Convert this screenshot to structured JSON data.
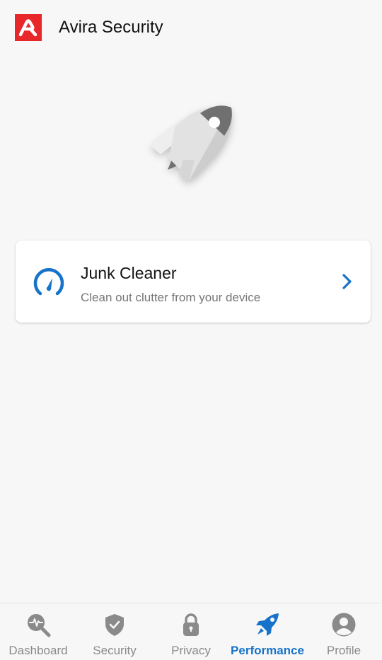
{
  "app": {
    "title": "Avira Security"
  },
  "colors": {
    "brand_red": "#e8272a",
    "accent_blue": "#1673c9",
    "inactive_gray": "#8a8a8a",
    "background": "#f7f7f7"
  },
  "hero": {
    "icon": "rocket-illustration"
  },
  "feature_card": {
    "icon": "speedometer-icon",
    "title": "Junk Cleaner",
    "subtitle": "Clean out clutter from your device",
    "action_icon": "chevron-right-icon"
  },
  "bottom_nav": {
    "active": "Performance",
    "items": [
      {
        "label": "Dashboard",
        "icon": "dashboard-icon"
      },
      {
        "label": "Security",
        "icon": "shield-check-icon"
      },
      {
        "label": "Privacy",
        "icon": "lock-icon"
      },
      {
        "label": "Performance",
        "icon": "rocket-icon"
      },
      {
        "label": "Profile",
        "icon": "person-icon"
      }
    ]
  }
}
